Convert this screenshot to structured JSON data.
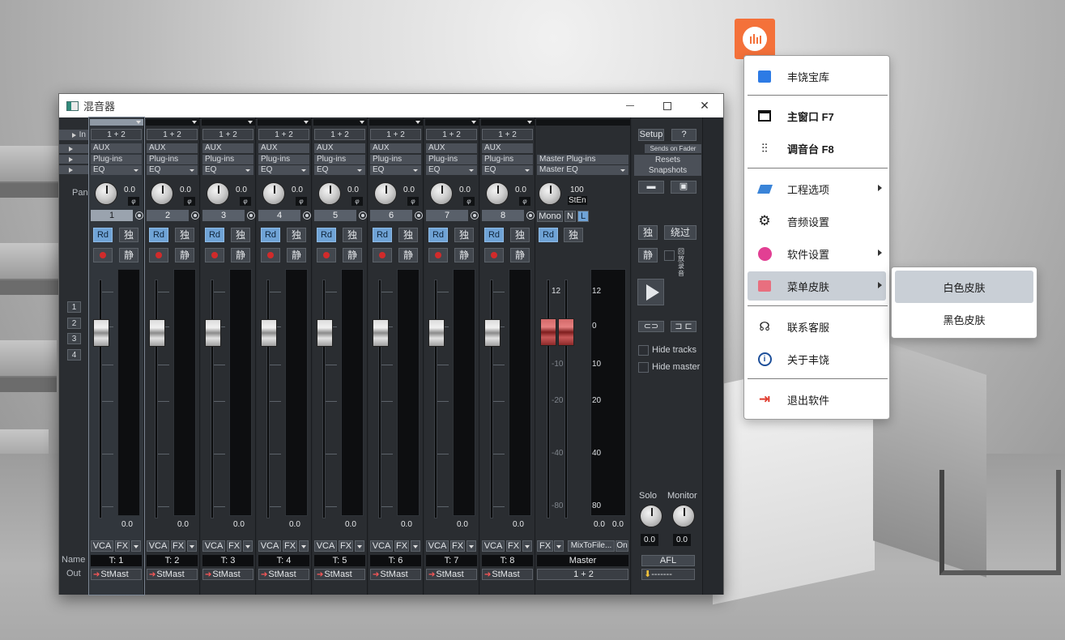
{
  "window": {
    "title": "混音器"
  },
  "left": {
    "in_label": "In",
    "pan_label": "Pan",
    "name_label": "Name",
    "out_label": "Out",
    "groups": [
      "1",
      "2",
      "3",
      "4"
    ]
  },
  "channels": [
    {
      "in": "1 + 2",
      "aux": "AUX",
      "plugins": "Plug-ins",
      "eq": "EQ",
      "pan": "0.0",
      "number": "1",
      "rd": "Rd",
      "solo": "独",
      "mute": "静",
      "peak": "0.0",
      "vca": "VCA",
      "fx": "FX",
      "name": "T: 1",
      "out": "StMast",
      "selected": true
    },
    {
      "in": "1 + 2",
      "aux": "AUX",
      "plugins": "Plug-ins",
      "eq": "EQ",
      "pan": "0.0",
      "number": "2",
      "rd": "Rd",
      "solo": "独",
      "mute": "静",
      "peak": "0.0",
      "vca": "VCA",
      "fx": "FX",
      "name": "T: 2",
      "out": "StMast"
    },
    {
      "in": "1 + 2",
      "aux": "AUX",
      "plugins": "Plug-ins",
      "eq": "EQ",
      "pan": "0.0",
      "number": "3",
      "rd": "Rd",
      "solo": "独",
      "mute": "静",
      "peak": "0.0",
      "vca": "VCA",
      "fx": "FX",
      "name": "T: 3",
      "out": "StMast"
    },
    {
      "in": "1 + 2",
      "aux": "AUX",
      "plugins": "Plug-ins",
      "eq": "EQ",
      "pan": "0.0",
      "number": "4",
      "rd": "Rd",
      "solo": "独",
      "mute": "静",
      "peak": "0.0",
      "vca": "VCA",
      "fx": "FX",
      "name": "T: 4",
      "out": "StMast"
    },
    {
      "in": "1 + 2",
      "aux": "AUX",
      "plugins": "Plug-ins",
      "eq": "EQ",
      "pan": "0.0",
      "number": "5",
      "rd": "Rd",
      "solo": "独",
      "mute": "静",
      "peak": "0.0",
      "vca": "VCA",
      "fx": "FX",
      "name": "T: 5",
      "out": "StMast"
    },
    {
      "in": "1 + 2",
      "aux": "AUX",
      "plugins": "Plug-ins",
      "eq": "EQ",
      "pan": "0.0",
      "number": "6",
      "rd": "Rd",
      "solo": "独",
      "mute": "静",
      "peak": "0.0",
      "vca": "VCA",
      "fx": "FX",
      "name": "T: 6",
      "out": "StMast"
    },
    {
      "in": "1 + 2",
      "aux": "AUX",
      "plugins": "Plug-ins",
      "eq": "EQ",
      "pan": "0.0",
      "number": "7",
      "rd": "Rd",
      "solo": "独",
      "mute": "静",
      "peak": "0.0",
      "vca": "VCA",
      "fx": "FX",
      "name": "T: 7",
      "out": "StMast"
    },
    {
      "in": "1 + 2",
      "aux": "AUX",
      "plugins": "Plug-ins",
      "eq": "EQ",
      "pan": "0.0",
      "number": "8",
      "rd": "Rd",
      "solo": "独",
      "mute": "静",
      "peak": "0.0",
      "vca": "VCA",
      "fx": "FX",
      "name": "T: 8",
      "out": "StMast"
    }
  ],
  "scale_labels": [
    "12",
    "0",
    "10",
    "20",
    "40",
    "80"
  ],
  "master": {
    "plugins": "Master Plug-ins",
    "eq": "Master EQ",
    "pan": "100",
    "pan_mode": "StEn",
    "mono": "Mono",
    "n": "N",
    "l": "L",
    "rd": "Rd",
    "solo": "独",
    "scale_labels": [
      "12",
      "0",
      "-10",
      "-20",
      "-40",
      "-80"
    ],
    "meter_labels": [
      "12",
      "0",
      "10",
      "20",
      "40",
      "80"
    ],
    "peak_l": "0.0",
    "peak_r": "0.0",
    "fx": "FX",
    "mixtofile": "MixToFile...",
    "on": "On",
    "name": "Master",
    "out": "1 + 2"
  },
  "right": {
    "setup": "Setup",
    "help": "?",
    "sends_on_fader": "Sends on Fader",
    "resets": "Resets",
    "snapshots": "Snapshots",
    "solo": "独",
    "bypass": "绕过",
    "mute": "静",
    "record_label": "回放录音",
    "hide_tracks": "Hide tracks",
    "hide_master": "Hide master",
    "solo_label": "Solo",
    "monitor_label": "Monitor",
    "solo_val": "0.0",
    "monitor_val": "0.0",
    "afl": "AFL",
    "out": "-------"
  },
  "menu": {
    "items": [
      {
        "label": "丰饶宝库"
      },
      {
        "label": "主窗口  F7"
      },
      {
        "label": "调音台  F8"
      },
      {
        "label": "工程选项"
      },
      {
        "label": "音频设置"
      },
      {
        "label": "软件设置"
      },
      {
        "label": "菜单皮肤"
      },
      {
        "label": "联系客服"
      },
      {
        "label": "关于丰饶"
      },
      {
        "label": "退出软件"
      }
    ],
    "skin_submenu": [
      "白色皮肤",
      "黑色皮肤"
    ]
  },
  "colors": {
    "accent": "#f4713a",
    "record": "#d12b2b",
    "rd_blue": "#6fa3d6",
    "menu_highlight": "#c9cfd6"
  }
}
